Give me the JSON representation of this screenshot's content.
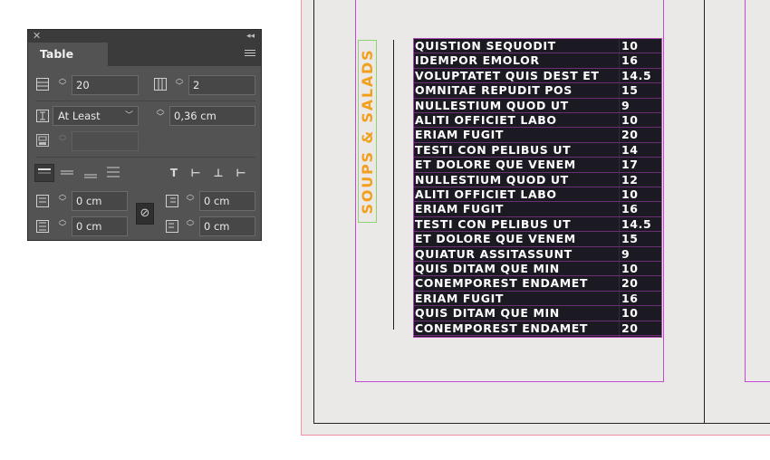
{
  "panel": {
    "title": "Table",
    "rows_value": "20",
    "columns_value": "2",
    "row_height_mode": "At Least",
    "row_height_value": "0,36 cm",
    "max_row_height_value": "",
    "inset_top_value": "0 cm",
    "inset_left_value": "0 cm",
    "inset_bottom_value": "0 cm",
    "inset_right_value": "0 cm",
    "icons": {
      "close": "close-icon",
      "collapse": "collapse-panel-icon",
      "menu": "panel-menu-icon",
      "rows": "rows-icon",
      "columns": "columns-icon",
      "row_height": "row-height-icon",
      "max_row_height": "max-height-icon",
      "link": "link-icon"
    }
  },
  "menu": {
    "heading": "SOUPS & SALADS",
    "rows": [
      {
        "item": "QUISTION SEQUODIT",
        "price": "10"
      },
      {
        "item": "IDEMPOR EMOLOR",
        "price": "16"
      },
      {
        "item": "VOLUPTATET QUIS DEST ET",
        "price": "14.5"
      },
      {
        "item": "OMNITAE REPUDIT POS",
        "price": "15"
      },
      {
        "item": "NULLESTIUM QUOD UT",
        "price": "9"
      },
      {
        "item": "ALITI OFFICIET LABO",
        "price": "10"
      },
      {
        "item": "ERIAM FUGIT",
        "price": "20"
      },
      {
        "item": "TESTI CON PELIBUS UT",
        "price": "14"
      },
      {
        "item": "ET DOLORE QUE VENEM",
        "price": "17"
      },
      {
        "item": "NULLESTIUM QUOD UT",
        "price": "12"
      },
      {
        "item": "ALITI OFFICIET LABO",
        "price": "10"
      },
      {
        "item": "ERIAM FUGIT",
        "price": "16"
      },
      {
        "item": "TESTI CON PELIBUS UT",
        "price": "14.5"
      },
      {
        "item": "ET DOLORE QUE VENEM",
        "price": "15"
      },
      {
        "item": "QUIATUR ASSITASSUNT",
        "price": "9"
      },
      {
        "item": "QUIS DITAM QUE MIN",
        "price": "10"
      },
      {
        "item": "CONEMPOREST ENDAMET",
        "price": "20"
      },
      {
        "item": "ERIAM FUGIT",
        "price": "16"
      },
      {
        "item": "QUIS DITAM QUE MIN",
        "price": "10"
      },
      {
        "item": "CONEMPOREST ENDAMET",
        "price": "20"
      }
    ]
  },
  "colors": {
    "heading": "#f2a01c",
    "table_bg": "#1b1a22",
    "frame_guides": "#c04bd3",
    "bleed_guide": "#f28fa0",
    "panel_bg": "#535353"
  }
}
